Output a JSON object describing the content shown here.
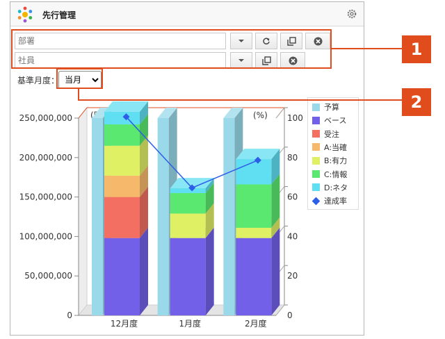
{
  "header": {
    "title": "先行管理"
  },
  "filters": {
    "department": {
      "placeholder": "部署",
      "value": ""
    },
    "employee": {
      "placeholder": "社員",
      "value": ""
    }
  },
  "month": {
    "label": "基準月度：",
    "selected": "当月",
    "options": [
      "当月"
    ]
  },
  "callouts": [
    "1",
    "2"
  ],
  "colors": {
    "accent": "#e04c1c",
    "予算": "#9ad9ea",
    "ベース": "#7260e8",
    "受注": "#f26f62",
    "A:当確": "#f6b86b",
    "B:有力": "#e0f065",
    "C:情報": "#5ae870",
    "D:ネタ": "#60def2",
    "達成率": "#2d5ee8"
  },
  "chart_data": {
    "type": "bar",
    "categories": [
      "12月度",
      "1月度",
      "2月度"
    ],
    "left_axis": {
      "label": "(円)",
      "ticks": [
        "250,000,000",
        "200,000,000",
        "150,000,000",
        "100,000,000",
        "50,000,000",
        "0"
      ],
      "ylim": [
        0,
        250000000
      ]
    },
    "right_axis": {
      "label": "(%)",
      "ticks": [
        "100",
        "80",
        "60",
        "40",
        "20",
        "0"
      ],
      "ylim": [
        0,
        100
      ]
    },
    "budget": {
      "name": "予算",
      "values": [
        250000000,
        250000000,
        250000000
      ]
    },
    "stacked": [
      {
        "name": "ベース",
        "values": [
          98000000,
          98000000,
          98000000
        ]
      },
      {
        "name": "受注",
        "values": [
          52000000,
          0,
          0
        ]
      },
      {
        "name": "A:当確",
        "values": [
          27000000,
          0,
          0
        ]
      },
      {
        "name": "B:有力",
        "values": [
          38000000,
          31000000,
          13000000
        ]
      },
      {
        "name": "C:情報",
        "values": [
          27000000,
          26000000,
          55000000
        ]
      },
      {
        "name": "D:ネタ",
        "values": [
          16000000,
          6000000,
          32000000
        ]
      }
    ],
    "line": {
      "name": "達成率",
      "values": [
        98,
        62,
        76
      ]
    },
    "legend": [
      "予算",
      "ベース",
      "受注",
      "A:当確",
      "B:有力",
      "C:情報",
      "D:ネタ",
      "達成率"
    ],
    "legend_position": "right",
    "grid": false
  }
}
